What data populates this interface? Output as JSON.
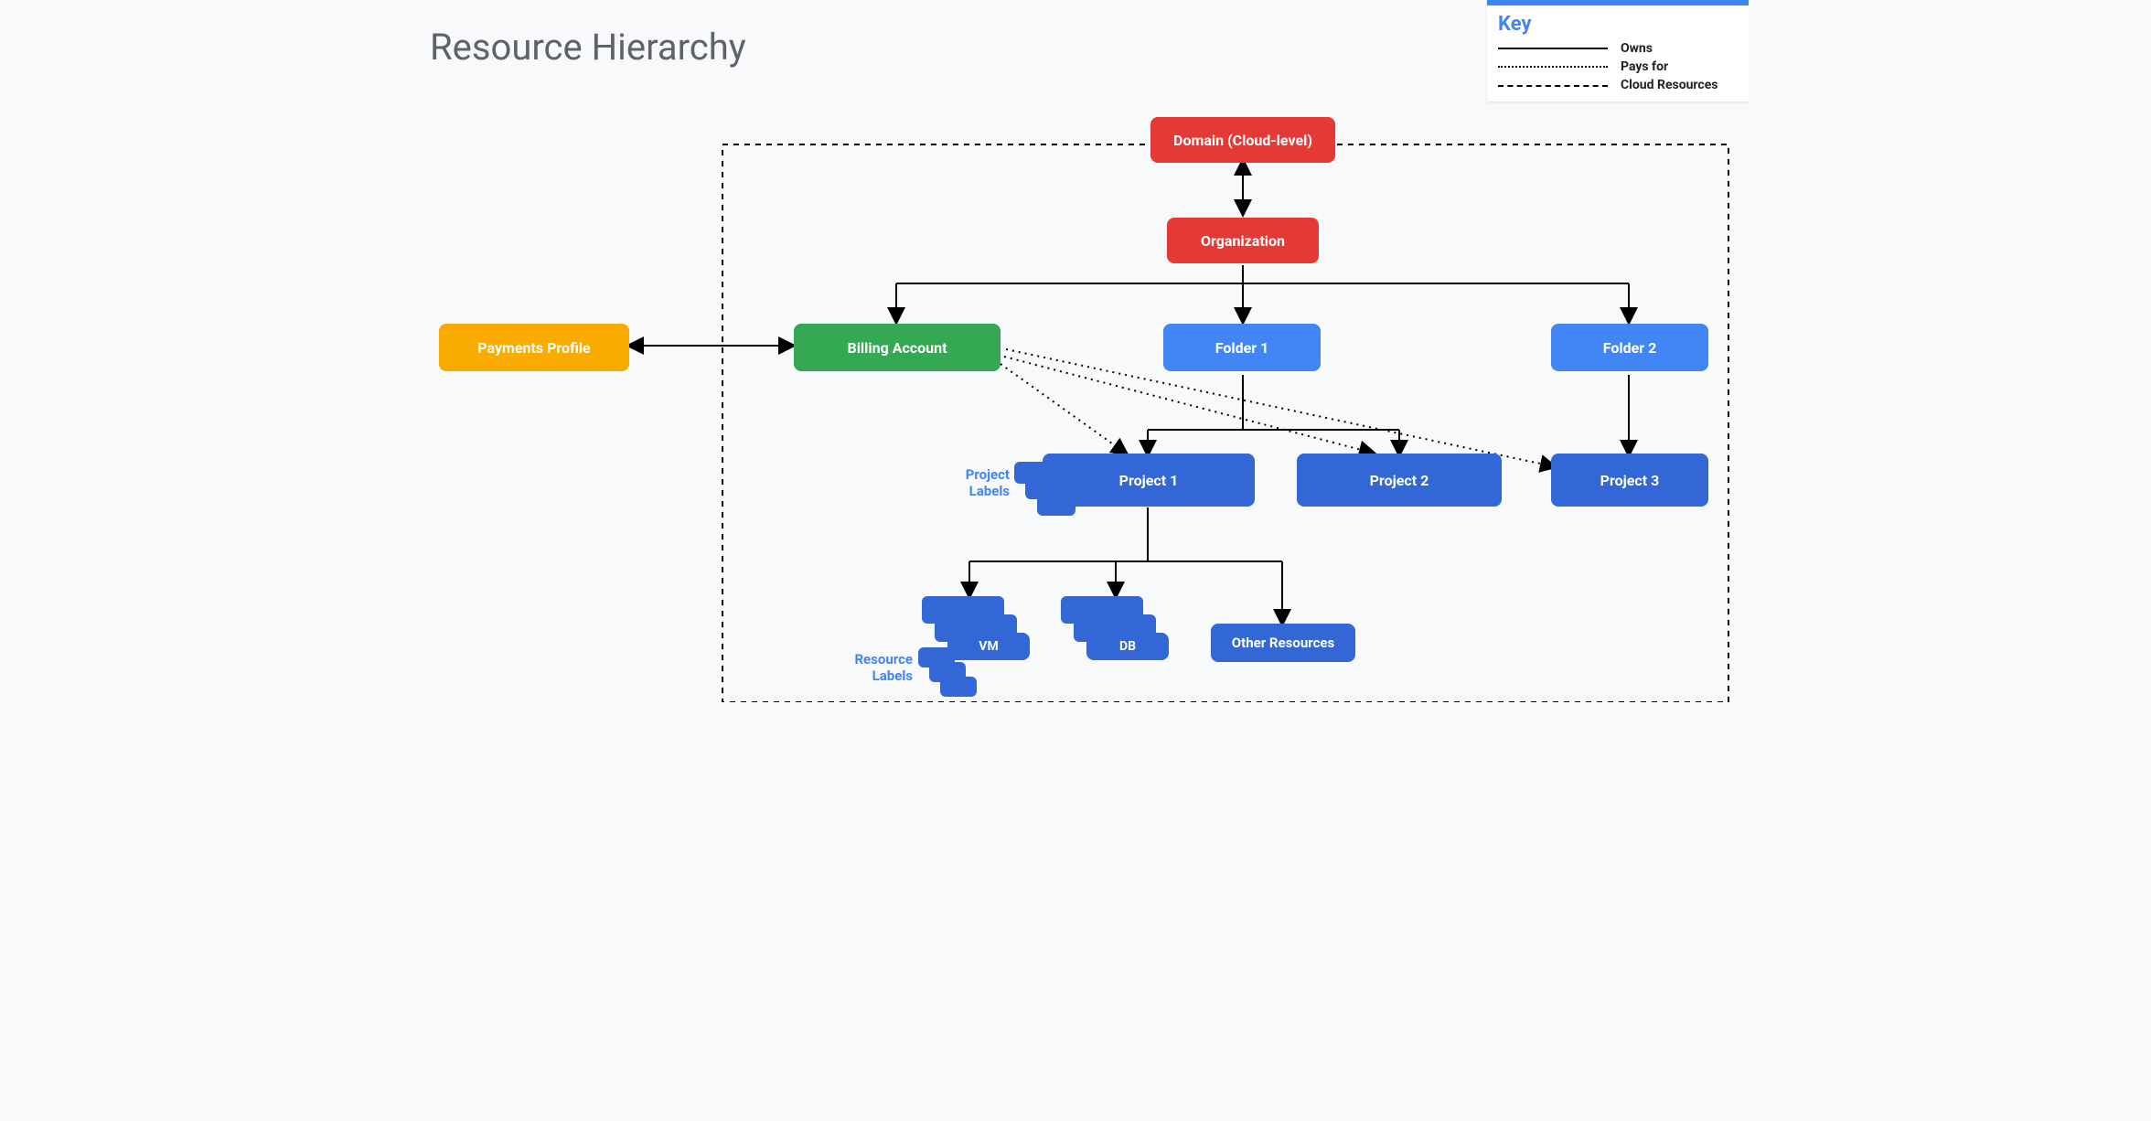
{
  "title": "Resource Hierarchy",
  "nodes": {
    "domain": "Domain (Cloud-level)",
    "organization": "Organization",
    "billing": "Billing Account",
    "payments": "Payments Profile",
    "folder1": "Folder 1",
    "folder2": "Folder 2",
    "project1": "Project 1",
    "project2": "Project 2",
    "project3": "Project 3",
    "vm": "VM",
    "db": "DB",
    "other": "Other Resources"
  },
  "labels": {
    "project_labels": "Project\nLabels",
    "resource_labels": "Resource\nLabels"
  },
  "key": {
    "title": "Key",
    "owns": "Owns",
    "pays": "Pays for",
    "cloud": "Cloud Resources"
  },
  "colors": {
    "red": "#e53935",
    "green": "#34a853",
    "blue": "#4285f4",
    "blue_d": "#3367d6",
    "yellow": "#f9ab00"
  }
}
